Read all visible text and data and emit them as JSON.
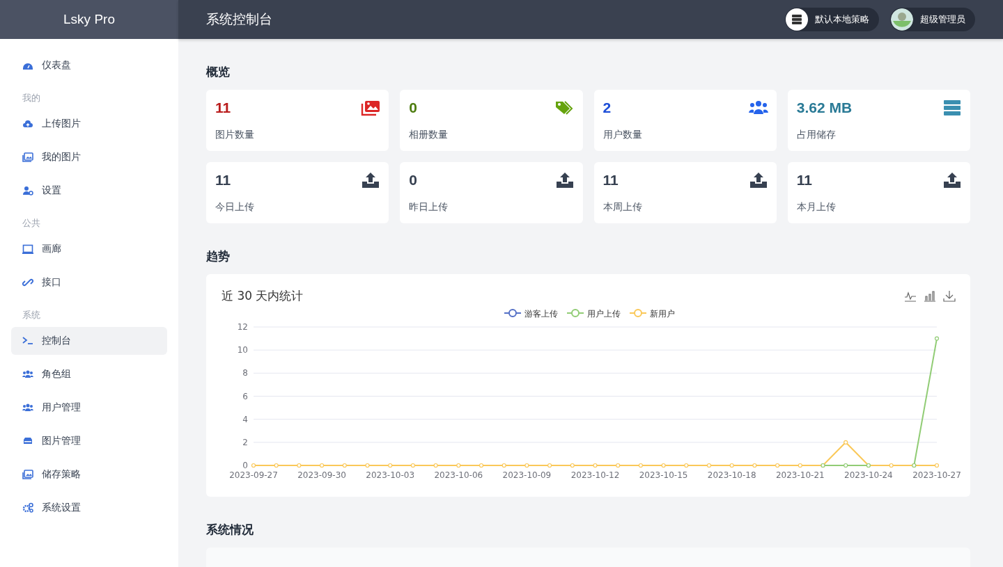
{
  "brand": "Lsky Pro",
  "header": {
    "title": "系统控制台",
    "policy": "默认本地策略",
    "user": "超级管理员"
  },
  "sidebar": [
    {
      "kind": "item",
      "label": "仪表盘",
      "selected": false
    },
    {
      "kind": "heading",
      "label": "我的"
    },
    {
      "kind": "item",
      "label": "上传图片",
      "selected": false
    },
    {
      "kind": "item",
      "label": "我的图片",
      "selected": false
    },
    {
      "kind": "item",
      "label": "设置",
      "selected": false
    },
    {
      "kind": "heading",
      "label": "公共"
    },
    {
      "kind": "item",
      "label": "画廊",
      "selected": false
    },
    {
      "kind": "item",
      "label": "接口",
      "selected": false
    },
    {
      "kind": "heading",
      "label": "系统"
    },
    {
      "kind": "item",
      "label": "控制台",
      "selected": true
    },
    {
      "kind": "item",
      "label": "角色组",
      "selected": false
    },
    {
      "kind": "item",
      "label": "用户管理",
      "selected": false
    },
    {
      "kind": "item",
      "label": "图片管理",
      "selected": false
    },
    {
      "kind": "item",
      "label": "储存策略",
      "selected": false
    },
    {
      "kind": "item",
      "label": "系统设置",
      "selected": false
    }
  ],
  "overview": {
    "title": "概览",
    "stats": [
      {
        "value": "11",
        "label": "图片数量",
        "color": "#b91c1c"
      },
      {
        "value": "0",
        "label": "相册数量",
        "color": "#4d7c0f"
      },
      {
        "value": "2",
        "label": "用户数量",
        "color": "#1d4ed8"
      },
      {
        "value": "3.62 MB",
        "label": "占用储存",
        "color": "#2a7a96"
      },
      {
        "value": "11",
        "label": "今日上传",
        "color": "#374151"
      },
      {
        "value": "0",
        "label": "昨日上传",
        "color": "#374151"
      },
      {
        "value": "11",
        "label": "本周上传",
        "color": "#374151"
      },
      {
        "value": "11",
        "label": "本月上传",
        "color": "#374151"
      }
    ]
  },
  "trend": {
    "title": "趋势",
    "chart_data": {
      "type": "line",
      "title": "近 30 天内统计",
      "grid": true,
      "legend": "top",
      "categories": [
        "2023-09-27",
        null,
        null,
        "2023-09-30",
        null,
        null,
        "2023-10-03",
        null,
        null,
        "2023-10-06",
        null,
        null,
        "2023-10-09",
        null,
        null,
        "2023-10-12",
        null,
        null,
        "2023-10-15",
        null,
        null,
        "2023-10-18",
        null,
        null,
        "2023-10-21",
        null,
        null,
        "2023-10-24",
        null,
        null,
        "2023-10-27"
      ],
      "series": [
        {
          "name": "游客上传",
          "color": "#5470c6",
          "values": [
            null,
            null,
            null,
            null,
            null,
            null,
            null,
            null,
            null,
            null,
            null,
            null,
            null,
            null,
            null,
            null,
            null,
            null,
            null,
            null,
            null,
            null,
            null,
            null,
            null,
            null,
            null,
            null,
            null,
            null,
            null
          ]
        },
        {
          "name": "用户上传",
          "color": "#91cc75",
          "marker": "circle",
          "values": [
            null,
            null,
            null,
            null,
            null,
            null,
            null,
            null,
            null,
            null,
            null,
            null,
            null,
            null,
            null,
            null,
            null,
            null,
            null,
            null,
            null,
            null,
            null,
            null,
            null,
            0,
            0,
            0,
            null,
            0,
            11
          ]
        },
        {
          "name": "新用户",
          "color": "#fac858",
          "marker": "circle",
          "values": [
            0,
            0,
            0,
            0,
            0,
            0,
            0,
            0,
            0,
            0,
            0,
            0,
            0,
            0,
            0,
            0,
            0,
            0,
            0,
            0,
            0,
            0,
            0,
            0,
            0,
            0,
            2,
            0,
            0,
            0,
            0
          ]
        }
      ],
      "ylim": [
        0,
        12
      ],
      "yticks": [
        0,
        2,
        4,
        6,
        8,
        10,
        12
      ]
    }
  },
  "system": {
    "title": "系统情况"
  }
}
